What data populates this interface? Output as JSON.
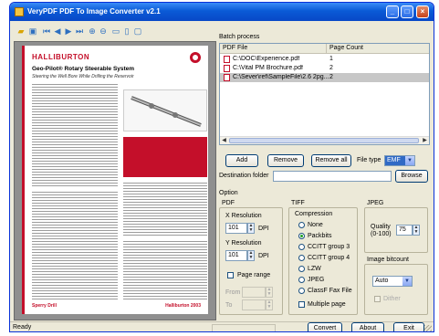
{
  "window": {
    "title": "VeryPDF  PDF To Image Converter v2.1",
    "minimize_glyph": "_",
    "maximize_glyph": "□",
    "close_glyph": "×"
  },
  "toolbar": {
    "icons": [
      "open-folder-icon",
      "save-icon",
      "first-page-icon",
      "previous-page-icon",
      "next-page-icon",
      "last-page-icon",
      "zoom-in-icon",
      "zoom-out-icon",
      "page-view-icon",
      "fit-width-icon",
      "fit-page-icon"
    ]
  },
  "preview": {
    "logo_text": "HALLIBURTON",
    "title": "Geo-Pilot® Rotary Steerable System",
    "subtitle": "Steering the Well Bore While Drilling the Reservoir",
    "footer_left": "Sperry Drill",
    "footer_right": "Halliburton 2003",
    "accent_color": "#c40f2a"
  },
  "batch": {
    "group_label": "Batch process",
    "columns": [
      "PDF File",
      "Page Count"
    ],
    "rows": [
      {
        "file": "C:\\DOC\\Experience.pdf",
        "count": "1",
        "selected": false
      },
      {
        "file": "C:\\Vital PM Brochure.pdf",
        "count": "2",
        "selected": false
      },
      {
        "file": "C:\\Sever\\ref\\SampleFile\\2.6 2pg...",
        "count": "2",
        "selected": true
      }
    ]
  },
  "actions": {
    "add": "Add",
    "remove": "Remove",
    "remove_all": "Remove all",
    "file_type_label": "File type",
    "file_type_value": "EMF",
    "destination_label": "Destination folder",
    "destination_value": "",
    "browse": "Browse"
  },
  "option": {
    "group_label": "Option",
    "pdf_label": "PDF",
    "xres_label": "X Resolution",
    "xres_value": "101",
    "yres_label": "Y Resolution",
    "yres_value": "101",
    "dpi_label": "DPI",
    "page_range_label": "Page range",
    "from_label": "From",
    "to_label": "To"
  },
  "tiff": {
    "group_label": "TIFF",
    "compression_label": "Compression",
    "options": [
      "None",
      "Packbits",
      "CCITT group 3",
      "CCITT group 4",
      "LZW",
      "JPEG",
      "ClassF Fax File"
    ],
    "selected": "Packbits",
    "multiple_page": "Multiple page"
  },
  "jpeg": {
    "group_label": "JPEG",
    "quality_label": "Quality\n(0-100)",
    "quality_value": "75"
  },
  "bitcount": {
    "group_label": "Image bitcount",
    "value": "Auto",
    "dither_label": "Dither"
  },
  "footer": {
    "convert": "Convert",
    "about": "About",
    "exit": "Exit",
    "status": "Ready"
  }
}
